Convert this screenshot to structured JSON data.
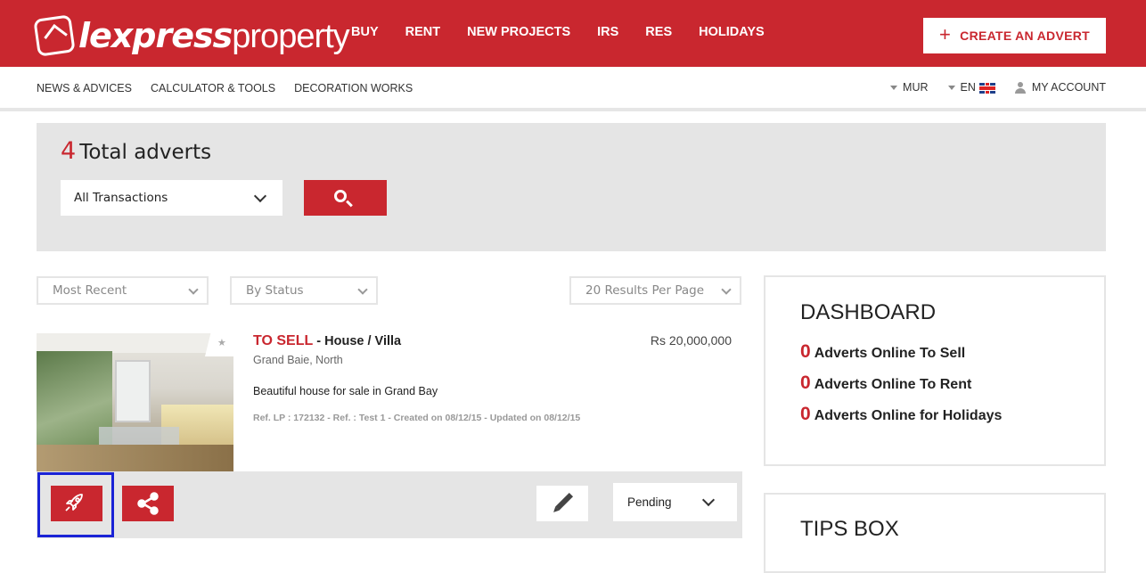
{
  "brand": {
    "logo_bold": "lexpress",
    "logo_light": "property"
  },
  "main_nav": [
    "BUY",
    "RENT",
    "NEW PROJECTS",
    "IRS",
    "RES",
    "HOLIDAYS"
  ],
  "create_advert": {
    "icon": "plus-icon",
    "label": "CREATE AN ADVERT"
  },
  "sub_nav": [
    "NEWS & ADVICES",
    "CALCULATOR & TOOLS",
    "DECORATION WORKS"
  ],
  "currency": "MUR",
  "language": "EN",
  "account": "MY ACCOUNT",
  "total": {
    "count": "4",
    "label": "Total adverts"
  },
  "transaction_select": "All Transactions",
  "filters": {
    "sort": "Most Recent",
    "status": "By Status",
    "per_page": "20 Results Per Page"
  },
  "listing": {
    "type": "TO SELL",
    "subtype": " - House / Villa",
    "price": "Rs 20,000,000",
    "location": "Grand Baie, North",
    "description": "Beautiful house for sale in Grand Bay",
    "refs": "Ref. LP : 172132 - Ref. : Test 1 - Created on 08/12/15 - Updated on 08/12/15",
    "status": "Pending"
  },
  "dashboard": {
    "title": "DASHBOARD",
    "rows": [
      {
        "count": "0",
        "label": "Adverts Online To Sell"
      },
      {
        "count": "0",
        "label": "Adverts Online To Rent"
      },
      {
        "count": "0",
        "label": "Adverts Online for Holidays"
      }
    ]
  },
  "tips": {
    "title": "TIPS BOX"
  },
  "colors": {
    "brand_red": "#c9272f",
    "highlight_blue": "#1a23d6",
    "panel_gray": "#e5e5e5"
  }
}
